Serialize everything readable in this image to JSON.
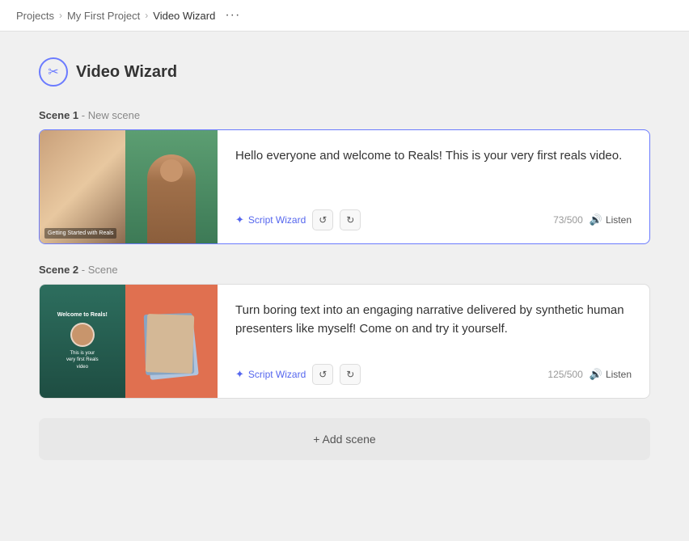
{
  "breadcrumb": {
    "projects": "Projects",
    "project": "My First Project",
    "current": "Video Wizard",
    "dots": "···"
  },
  "page": {
    "title": "Video Wizard",
    "wizard_icon": "✂"
  },
  "scenes": [
    {
      "label": "Scene 1",
      "sublabel": "New scene",
      "text": "Hello everyone and welcome to Reals! This is your very first reals video.",
      "char_count": "73/500",
      "listen_label": "Listen",
      "script_wizard_label": "Script Wizard",
      "thumb_caption": "Getting Started with Reals",
      "active": true
    },
    {
      "label": "Scene 2",
      "sublabel": "Scene",
      "text": "Turn boring text into an engaging narrative delivered by synthetic human presenters like myself! Come on and try it yourself.",
      "char_count": "125/500",
      "listen_label": "Listen",
      "script_wizard_label": "Script Wizard",
      "active": false
    }
  ],
  "add_scene_btn": "+ Add scene"
}
